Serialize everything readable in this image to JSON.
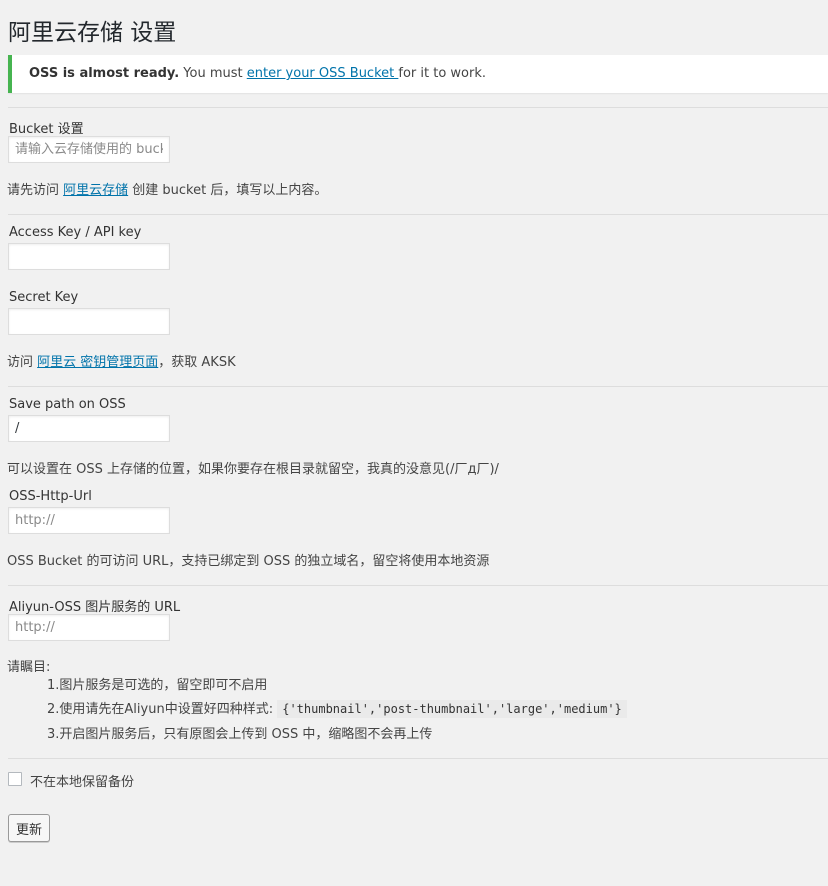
{
  "page": {
    "title": "阿里云存储 设置"
  },
  "notice": {
    "strong": "OSS is almost ready.",
    "before_link": " You must ",
    "link": "enter your OSS Bucket ",
    "after_link": "for it to work."
  },
  "bucket": {
    "label": "Bucket 设置",
    "placeholder": "请输入云存储使用的 bucket",
    "desc_before": "请先访问 ",
    "desc_link": "阿里云存储",
    "desc_after": " 创建 bucket 后，填写以上内容。"
  },
  "access_key": {
    "label": "Access Key / API key",
    "value": ""
  },
  "secret_key": {
    "label": "Secret Key",
    "value": "",
    "desc_before": "访问 ",
    "desc_link": "阿里云 密钥管理页面",
    "desc_after": "，获取 AKSK"
  },
  "save_path": {
    "label": "Save path on OSS",
    "value": "/",
    "desc": "可以设置在 OSS 上存储的位置，如果你要存在根目录就留空，我真的没意见(/厂д厂)/"
  },
  "http_url": {
    "label": "OSS-Http-Url",
    "placeholder": "http://",
    "desc": "OSS Bucket 的可访问 URL，支持已绑定到 OSS 的独立域名，留空将使用本地资源"
  },
  "img_service": {
    "label": "Aliyun-OSS 图片服务的 URL",
    "placeholder": "http://",
    "note_title": "请瞩目:",
    "note1": "1.图片服务是可选的，留空即可不启用",
    "note2_prefix": "2.使用请先在Aliyun中设置好四种样式: ",
    "note2_code": "{'thumbnail','post-thumbnail','large','medium'}",
    "note3": "3.开启图片服务后，只有原图会上传到 OSS 中，缩略图不会再上传"
  },
  "nolocal": {
    "label": "不在本地保留备份",
    "checked": false
  },
  "submit": {
    "label": "更新"
  }
}
